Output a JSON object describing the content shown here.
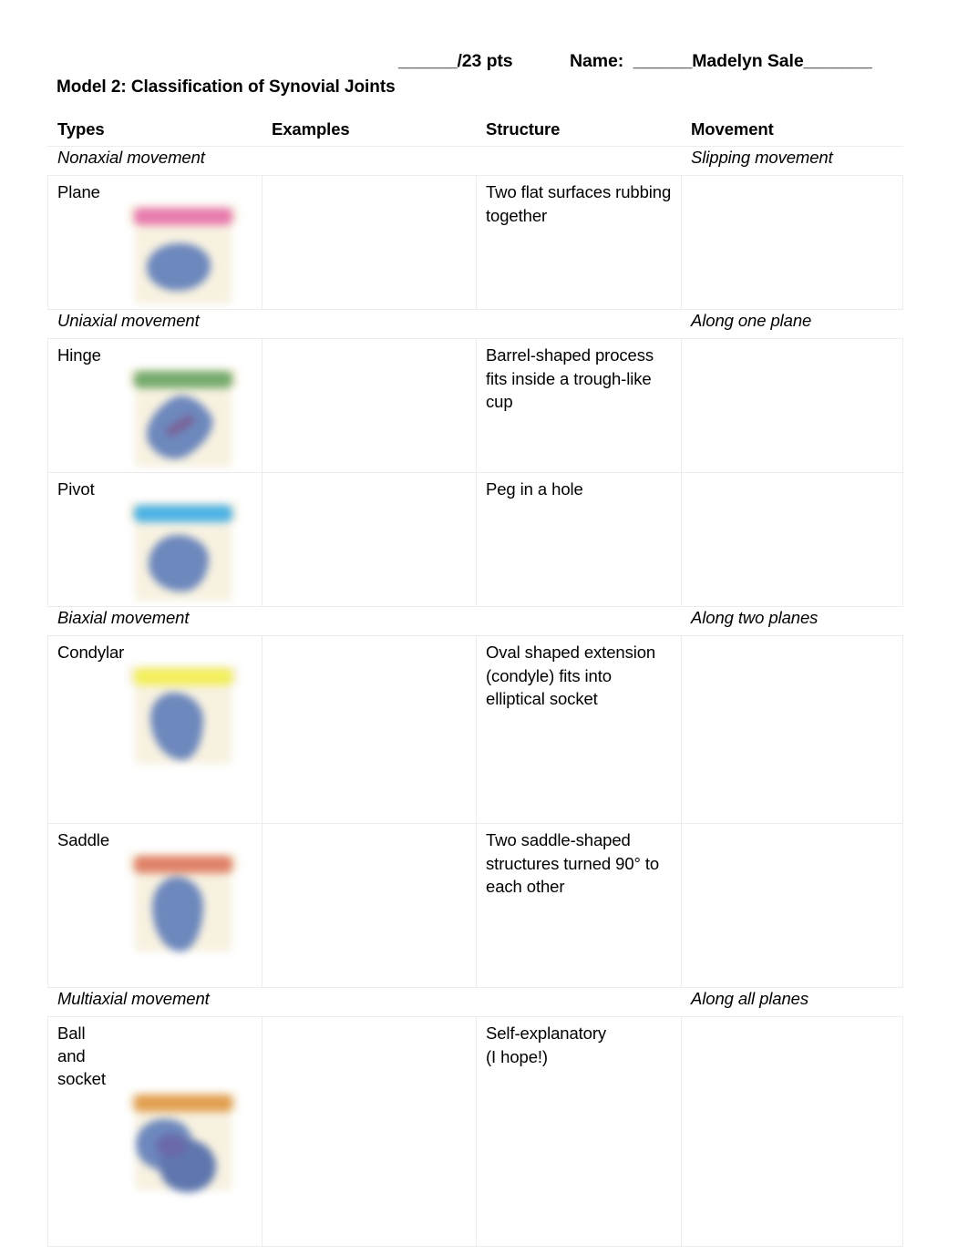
{
  "header": {
    "points": "______/23 pts",
    "name_field": "Name:  ______Madelyn Sale_______",
    "title": "Model 2: Classification of Synovial Joints"
  },
  "table": {
    "columns": [
      "Types",
      "Examples",
      "Structure",
      "Movement"
    ],
    "groups": [
      {
        "type_label": "Nonaxial movement",
        "examples_label": "",
        "structure_label": "",
        "movement_label": "Slipping movement",
        "rows": [
          {
            "type": "Plane",
            "examples": "",
            "structure": "Two flat surfaces rubbing together",
            "movement": "",
            "thumb_class": "t-plane",
            "bar_color": "#e87cae"
          }
        ]
      },
      {
        "type_label": "Uniaxial movement",
        "examples_label": "",
        "structure_label": "",
        "movement_label": "Along one plane",
        "rows": [
          {
            "type": "Hinge",
            "examples": "",
            "structure": "Barrel-shaped process fits inside a trough-like cup",
            "movement": "",
            "thumb_class": "t-hinge",
            "bar_color": "#76ab6d"
          },
          {
            "type": "Pivot",
            "examples": "",
            "structure": "Peg in a hole",
            "movement": "",
            "thumb_class": "t-pivot",
            "bar_color": "#4fb3e4"
          }
        ]
      },
      {
        "type_label": "Biaxial movement",
        "examples_label": "",
        "structure_label": "",
        "movement_label": "Along two planes",
        "rows": [
          {
            "type": "Condylar",
            "examples": "",
            "structure": "Oval shaped extension (condyle) fits into elliptical socket",
            "movement": "",
            "thumb_class": "t-condylar",
            "bar_color": "#f3ef5e"
          },
          {
            "type": "Saddle",
            "examples": "",
            "structure": "Two saddle-shaped structures turned 90° to each other",
            "movement": "",
            "thumb_class": "t-saddle",
            "bar_color": "#e08268"
          }
        ]
      },
      {
        "type_label": "Multiaxial movement",
        "examples_label": "",
        "structure_label": "",
        "movement_label": "Along all planes",
        "rows": [
          {
            "type": "Ball\nand\nsocket",
            "examples": "",
            "structure": "Self-explanatory\n(I hope!)",
            "movement": "",
            "thumb_class": "t-ball",
            "bar_color": "#e2a052"
          }
        ]
      }
    ]
  }
}
